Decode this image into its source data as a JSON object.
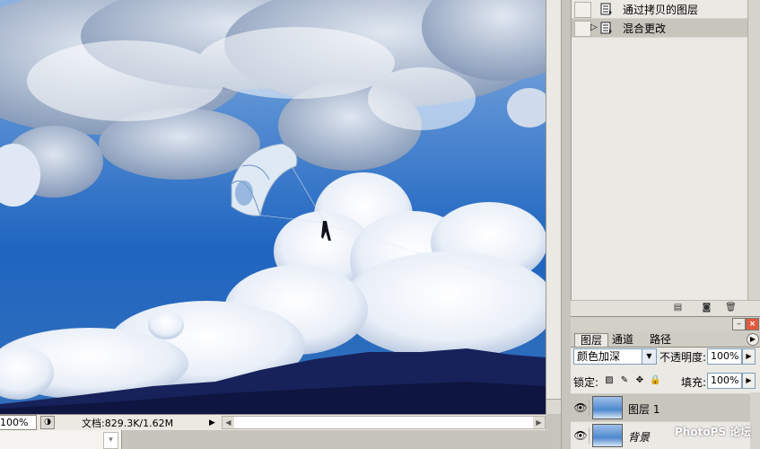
{
  "canvas": {
    "scene": "sky with clouds and parasailer"
  },
  "status_bar": {
    "zoom": "100%",
    "doc_info": "文档:829.3K/1.62M"
  },
  "history": {
    "items": [
      {
        "label": "通过拷贝的图层",
        "active": false
      },
      {
        "label": "混合更改",
        "active": true
      }
    ]
  },
  "layers": {
    "tabs": [
      "图层",
      "通道",
      "路径"
    ],
    "blend_mode": "颜色加深",
    "opacity_label": "不透明度:",
    "opacity": "100%",
    "lock_label": "锁定:",
    "fill_label": "填充:",
    "fill": "100%",
    "rows": [
      {
        "name": "图层 1",
        "selected": true
      },
      {
        "name": "背景",
        "selected": false
      }
    ]
  },
  "watermark": "PhotoPS 论坛",
  "colors": {
    "sky_deep": "#1c5fb8",
    "panel_bg": "#ebe9e4",
    "selected_row": "#c8c5bd"
  }
}
